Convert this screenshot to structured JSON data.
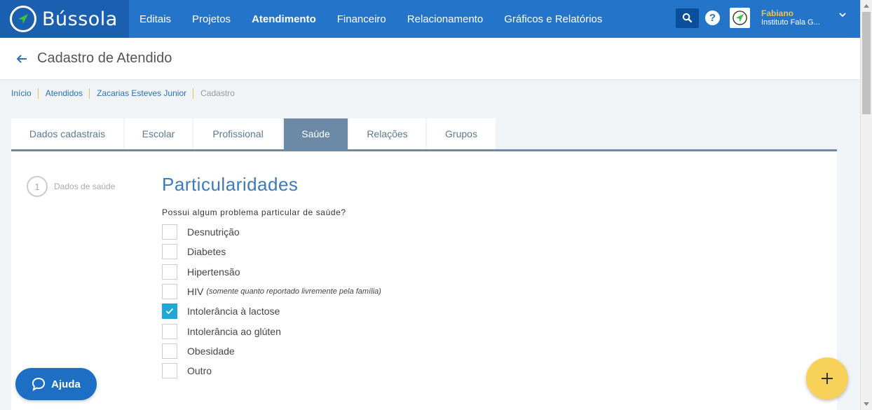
{
  "app": {
    "name": "Bússola"
  },
  "nav": {
    "items": [
      "Editais",
      "Projetos",
      "Atendimento",
      "Financeiro",
      "Relacionamento",
      "Gráficos e Relatórios"
    ],
    "active": "Atendimento"
  },
  "user": {
    "name": "Fabiano",
    "org": "Instituto Fala G..."
  },
  "header": {
    "title": "Cadastro de Atendido"
  },
  "breadcrumb": [
    "Início",
    "Atendidos",
    "Zacarias Esteves Junior",
    "Cadastro"
  ],
  "tabs": [
    "Dados cadastrais",
    "Escolar",
    "Profissional",
    "Saúde",
    "Relações",
    "Grupos"
  ],
  "active_tab": "Saúde",
  "step": {
    "number": "1",
    "label": "Dados de saúde"
  },
  "section": {
    "title": "Particularidades",
    "question": "Possui algum problema particular de saúde?",
    "options": [
      {
        "label": "Desnutrição",
        "note": "",
        "checked": false
      },
      {
        "label": "Diabetes",
        "note": "",
        "checked": false
      },
      {
        "label": "Hipertensão",
        "note": "",
        "checked": false
      },
      {
        "label": "HIV",
        "note": "(somente quanto reportado livremente pela família)",
        "checked": false
      },
      {
        "label": "Intolerância à lactose",
        "note": "",
        "checked": true
      },
      {
        "label": "Intolerância ao glúten",
        "note": "",
        "checked": false
      },
      {
        "label": "Obesidade",
        "note": "",
        "checked": false
      },
      {
        "label": "Outro",
        "note": "",
        "checked": false
      }
    ]
  },
  "help_button": {
    "label": "Ajuda"
  },
  "colors": {
    "nav": "#2474c9",
    "accent": "#1fa7d8",
    "fab": "#f7d15a"
  }
}
